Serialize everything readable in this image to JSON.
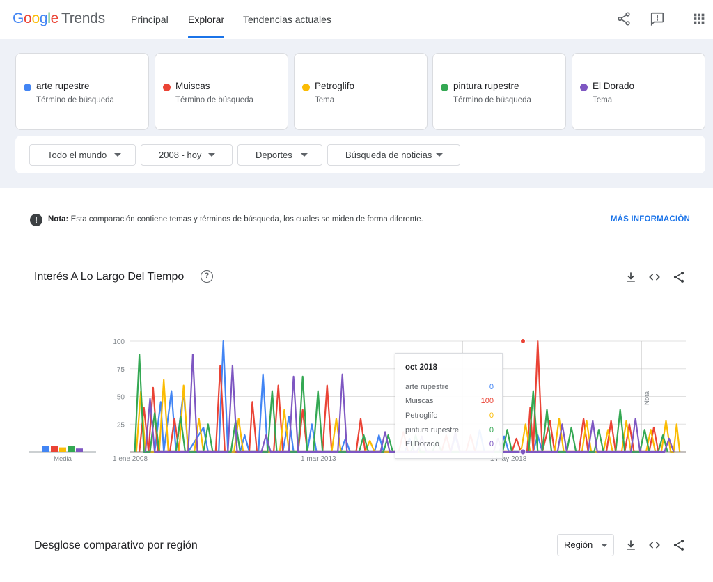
{
  "header": {
    "logo_google": "Google",
    "logo_trends": "Trends",
    "tabs": [
      "Principal",
      "Explorar",
      "Tendencias actuales"
    ],
    "active_tab": "Explorar"
  },
  "terms": [
    {
      "name": "arte rupestre",
      "type": "Término de búsqueda",
      "color": "#4285f4"
    },
    {
      "name": "Muiscas",
      "type": "Término de búsqueda",
      "color": "#ea4335"
    },
    {
      "name": "Petroglifo",
      "type": "Tema",
      "color": "#fbbc04"
    },
    {
      "name": "pintura rupestre",
      "type": "Término de búsqueda",
      "color": "#34a853"
    },
    {
      "name": "El Dorado",
      "type": "Tema",
      "color": "#7e57c2"
    }
  ],
  "filters": {
    "region": "Todo el mundo",
    "period": "2008 - hoy",
    "category": "Deportes",
    "search_type": "Búsqueda de noticias"
  },
  "note": {
    "label": "Nota:",
    "text": "Esta comparación contiene temas y términos de búsqueda, los cuales se miden de forma diferente.",
    "link": "MÁS INFORMACIÓN"
  },
  "interest": {
    "title": "Interés A Lo Largo Del Tiempo",
    "average_label": "Media",
    "note_marker": "Nota",
    "tooltip": {
      "title": "oct 2018",
      "rows": [
        {
          "name": "arte rupestre",
          "value": "0",
          "color": "#4285f4"
        },
        {
          "name": "Muiscas",
          "value": "100",
          "color": "#ea4335"
        },
        {
          "name": "Petroglifo",
          "value": "0",
          "color": "#fbbc04"
        },
        {
          "name": "pintura rupestre",
          "value": "0",
          "color": "#34a853"
        },
        {
          "name": "El Dorado",
          "value": "0",
          "color": "#7e57c2"
        }
      ]
    }
  },
  "region_section": {
    "title": "Desglose comparativo por región",
    "selector": "Región"
  },
  "icons": [
    "share-icon",
    "feedback-icon",
    "apps-icon",
    "help-icon",
    "download-icon",
    "embed-icon"
  ],
  "chart_data": {
    "type": "line",
    "x_tick_labels": [
      "1 ene 2008",
      "1 mar 2013",
      "1 may 2018"
    ],
    "x_range": [
      "2008-01",
      "2023-03"
    ],
    "ylim": [
      0,
      100
    ],
    "y_ticks": [
      0,
      25,
      50,
      75,
      100
    ],
    "grid": true,
    "averages": [
      {
        "name": "arte rupestre",
        "value": 5
      },
      {
        "name": "Muiscas",
        "value": 5
      },
      {
        "name": "Petroglifo",
        "value": 4
      },
      {
        "name": "pintura rupestre",
        "value": 5
      },
      {
        "name": "El Dorado",
        "value": 3
      }
    ],
    "series": [
      {
        "name": "arte rupestre",
        "color": "#4285f4",
        "peaks": [
          [
            0.8,
            0
          ],
          [
            1.0,
            45
          ],
          [
            1.1,
            0
          ],
          [
            1.35,
            55
          ],
          [
            1.5,
            0
          ],
          [
            1.75,
            55
          ],
          [
            1.9,
            0
          ],
          [
            2.4,
            22
          ],
          [
            2.55,
            0
          ],
          [
            2.9,
            0
          ],
          [
            3.05,
            100
          ],
          [
            3.2,
            0
          ],
          [
            3.6,
            0
          ],
          [
            3.75,
            15
          ],
          [
            3.9,
            0
          ],
          [
            4.2,
            0
          ],
          [
            4.35,
            70
          ],
          [
            4.5,
            0
          ],
          [
            5.0,
            0
          ],
          [
            5.2,
            32
          ],
          [
            5.35,
            0
          ],
          [
            5.8,
            0
          ],
          [
            5.95,
            25
          ],
          [
            6.1,
            0
          ],
          [
            6.9,
            0
          ],
          [
            7.05,
            12
          ],
          [
            7.2,
            0
          ],
          [
            8.0,
            0
          ],
          [
            8.15,
            15
          ],
          [
            8.3,
            0
          ],
          [
            9.0,
            0
          ],
          [
            9.15,
            12
          ],
          [
            9.3,
            0
          ],
          [
            10.5,
            0
          ],
          [
            10.65,
            14
          ],
          [
            10.8,
            0
          ],
          [
            11.3,
            0
          ],
          [
            11.45,
            20
          ],
          [
            11.6,
            0
          ],
          [
            12.1,
            0
          ],
          [
            12.25,
            14
          ],
          [
            12.4,
            0
          ],
          [
            13.2,
            0
          ],
          [
            13.35,
            15
          ],
          [
            13.5,
            0
          ]
        ]
      },
      {
        "name": "Muiscas",
        "color": "#ea4335",
        "peaks": [
          [
            0.3,
            0
          ],
          [
            0.45,
            40
          ],
          [
            0.6,
            0
          ],
          [
            0.75,
            58
          ],
          [
            0.9,
            0
          ],
          [
            1.3,
            0
          ],
          [
            1.45,
            30
          ],
          [
            1.6,
            0
          ],
          [
            2.8,
            0
          ],
          [
            2.95,
            78
          ],
          [
            3.1,
            0
          ],
          [
            3.9,
            0
          ],
          [
            4.0,
            45
          ],
          [
            4.15,
            0
          ],
          [
            4.7,
            0
          ],
          [
            4.85,
            60
          ],
          [
            5.0,
            0
          ],
          [
            5.5,
            0
          ],
          [
            5.65,
            38
          ],
          [
            5.8,
            0
          ],
          [
            6.3,
            0
          ],
          [
            6.45,
            60
          ],
          [
            6.6,
            0
          ],
          [
            7.4,
            0
          ],
          [
            7.55,
            30
          ],
          [
            7.7,
            0
          ],
          [
            8.8,
            0
          ],
          [
            8.95,
            18
          ],
          [
            9.1,
            0
          ],
          [
            10.2,
            0
          ],
          [
            10.35,
            15
          ],
          [
            10.5,
            0
          ],
          [
            11.0,
            0
          ],
          [
            11.15,
            15
          ],
          [
            11.3,
            0
          ],
          [
            12.5,
            0
          ],
          [
            12.65,
            12
          ],
          [
            12.8,
            0
          ],
          [
            13.0,
            0
          ],
          [
            13.1,
            40
          ],
          [
            13.2,
            0
          ],
          [
            13.35,
            100
          ],
          [
            13.5,
            0
          ],
          [
            13.75,
            28
          ],
          [
            13.9,
            0
          ],
          [
            14.7,
            0
          ],
          [
            14.85,
            30
          ],
          [
            15.0,
            0
          ],
          [
            15.6,
            0
          ],
          [
            15.75,
            28
          ],
          [
            15.9,
            0
          ],
          [
            16.2,
            0
          ],
          [
            16.35,
            25
          ],
          [
            16.5,
            0
          ],
          [
            17.0,
            0
          ],
          [
            17.15,
            22
          ],
          [
            17.3,
            0
          ]
        ]
      },
      {
        "name": "Petroglifo",
        "color": "#fbbc04",
        "peaks": [
          [
            0.2,
            0
          ],
          [
            0.35,
            55
          ],
          [
            0.5,
            0
          ],
          [
            0.95,
            0
          ],
          [
            1.1,
            65
          ],
          [
            1.25,
            0
          ],
          [
            1.6,
            0
          ],
          [
            1.75,
            60
          ],
          [
            1.9,
            0
          ],
          [
            2.1,
            0
          ],
          [
            2.25,
            30
          ],
          [
            2.4,
            0
          ],
          [
            3.4,
            0
          ],
          [
            3.55,
            30
          ],
          [
            3.7,
            0
          ],
          [
            4.9,
            0
          ],
          [
            5.05,
            38
          ],
          [
            5.2,
            0
          ],
          [
            6.6,
            0
          ],
          [
            6.75,
            30
          ],
          [
            6.9,
            0
          ],
          [
            7.7,
            0
          ],
          [
            7.85,
            10
          ],
          [
            8.0,
            0
          ],
          [
            12.8,
            0
          ],
          [
            12.95,
            25
          ],
          [
            13.1,
            0
          ],
          [
            13.9,
            0
          ],
          [
            14.05,
            30
          ],
          [
            14.2,
            0
          ],
          [
            14.8,
            0
          ],
          [
            14.95,
            28
          ],
          [
            15.1,
            0
          ],
          [
            15.5,
            0
          ],
          [
            15.65,
            20
          ],
          [
            15.8,
            0
          ],
          [
            16.1,
            0
          ],
          [
            16.25,
            28
          ],
          [
            16.4,
            0
          ],
          [
            16.9,
            0
          ],
          [
            17.05,
            20
          ],
          [
            17.2,
            0
          ],
          [
            17.4,
            0
          ],
          [
            17.55,
            28
          ],
          [
            17.7,
            0
          ],
          [
            17.8,
            0
          ],
          [
            17.9,
            25
          ],
          [
            18.0,
            0
          ]
        ]
      },
      {
        "name": "pintura rupestre",
        "color": "#34a853",
        "peaks": [
          [
            0.15,
            0
          ],
          [
            0.3,
            88
          ],
          [
            0.45,
            0
          ],
          [
            0.65,
            0
          ],
          [
            0.8,
            35
          ],
          [
            0.95,
            0
          ],
          [
            1.5,
            0
          ],
          [
            1.65,
            32
          ],
          [
            1.8,
            0
          ],
          [
            2.4,
            0
          ],
          [
            2.55,
            25
          ],
          [
            2.7,
            0
          ],
          [
            3.3,
            0
          ],
          [
            3.45,
            28
          ],
          [
            3.6,
            0
          ],
          [
            4.5,
            0
          ],
          [
            4.65,
            55
          ],
          [
            4.8,
            0
          ],
          [
            5.5,
            0
          ],
          [
            5.65,
            68
          ],
          [
            5.8,
            0
          ],
          [
            6.0,
            0
          ],
          [
            6.15,
            55
          ],
          [
            6.3,
            0
          ],
          [
            7.5,
            0
          ],
          [
            7.65,
            15
          ],
          [
            7.8,
            0
          ],
          [
            8.3,
            0
          ],
          [
            8.45,
            15
          ],
          [
            8.6,
            0
          ],
          [
            9.2,
            0
          ],
          [
            9.35,
            15
          ],
          [
            9.5,
            0
          ],
          [
            9.9,
            0
          ],
          [
            10.05,
            10
          ],
          [
            10.2,
            0
          ],
          [
            12.2,
            0
          ],
          [
            12.35,
            20
          ],
          [
            12.5,
            0
          ],
          [
            13.05,
            0
          ],
          [
            13.2,
            55
          ],
          [
            13.35,
            0
          ],
          [
            13.5,
            0
          ],
          [
            13.65,
            38
          ],
          [
            13.8,
            0
          ],
          [
            14.3,
            0
          ],
          [
            14.45,
            22
          ],
          [
            14.6,
            0
          ],
          [
            15.2,
            0
          ],
          [
            15.35,
            20
          ],
          [
            15.5,
            0
          ],
          [
            15.9,
            0
          ],
          [
            16.05,
            38
          ],
          [
            16.2,
            0
          ],
          [
            16.7,
            0
          ],
          [
            16.85,
            20
          ],
          [
            17.0,
            0
          ],
          [
            17.3,
            0
          ],
          [
            17.45,
            15
          ],
          [
            17.6,
            0
          ]
        ]
      },
      {
        "name": "El Dorado",
        "color": "#7e57c2",
        "peaks": [
          [
            0.5,
            0
          ],
          [
            0.65,
            48
          ],
          [
            0.8,
            0
          ],
          [
            1.9,
            0
          ],
          [
            2.05,
            88
          ],
          [
            2.2,
            0
          ],
          [
            3.2,
            0
          ],
          [
            3.35,
            78
          ],
          [
            3.5,
            0
          ],
          [
            4.3,
            0
          ],
          [
            4.45,
            15
          ],
          [
            4.6,
            0
          ],
          [
            5.2,
            0
          ],
          [
            5.35,
            68
          ],
          [
            5.5,
            0
          ],
          [
            6.8,
            0
          ],
          [
            6.95,
            70
          ],
          [
            7.1,
            0
          ],
          [
            8.2,
            0
          ],
          [
            8.35,
            18
          ],
          [
            8.5,
            0
          ],
          [
            9.4,
            0
          ],
          [
            9.55,
            14
          ],
          [
            9.7,
            0
          ],
          [
            10.5,
            0
          ],
          [
            10.65,
            18
          ],
          [
            10.8,
            0
          ],
          [
            11.9,
            0
          ],
          [
            12.05,
            12
          ],
          [
            12.2,
            0
          ],
          [
            14.0,
            0
          ],
          [
            14.15,
            25
          ],
          [
            14.3,
            0
          ],
          [
            15.0,
            0
          ],
          [
            15.15,
            28
          ],
          [
            15.3,
            0
          ],
          [
            16.4,
            0
          ],
          [
            16.55,
            30
          ],
          [
            16.7,
            0
          ],
          [
            17.5,
            0
          ],
          [
            17.65,
            12
          ],
          [
            17.8,
            0
          ]
        ]
      }
    ]
  }
}
